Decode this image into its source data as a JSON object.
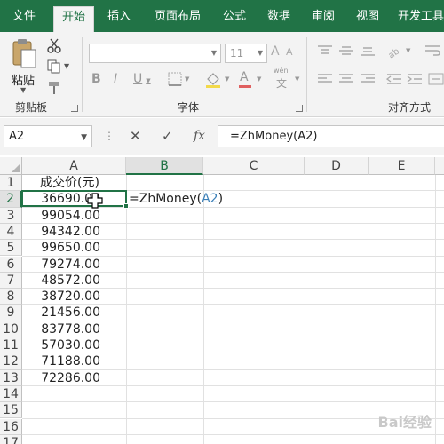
{
  "ribbon_tabs": [
    "文件",
    "开始",
    "插入",
    "页面布局",
    "公式",
    "数据",
    "审阅",
    "视图",
    "开发工具"
  ],
  "active_tab": "开始",
  "ribbon": {
    "paste_label": "粘贴",
    "clipboard_label": "剪贴板",
    "font_label": "字体",
    "alignment_label": "对齐方式",
    "font_size": "11",
    "font_name": "",
    "wen_label": "wén",
    "wen_char": "文"
  },
  "formula_bar": {
    "name_box": "A2",
    "formula": "=ZhMoney(A2)",
    "fx_label": "fx"
  },
  "sheet": {
    "columns": [
      "A",
      "B",
      "C",
      "D",
      "E"
    ],
    "selected_column": "B",
    "rows": [
      "1",
      "2",
      "3",
      "4",
      "5",
      "6",
      "7",
      "8",
      "9",
      "10",
      "11",
      "12",
      "13",
      "14",
      "15",
      "16",
      "17"
    ],
    "header_cell": "成交价(元)",
    "values": [
      "36690.00",
      "99054.00",
      "94342.00",
      "99650.00",
      "79274.00",
      "48572.00",
      "38720.00",
      "21456.00",
      "83778.00",
      "57030.00",
      "71188.00",
      "72286.00"
    ],
    "editing_cell": {
      "prefix": "=ZhMoney(",
      "ref": "A2",
      "suffix": ")"
    }
  },
  "watermark": "Bai经验",
  "colors": {
    "accent": "#217346",
    "ref_blue": "#3a7fb8"
  }
}
